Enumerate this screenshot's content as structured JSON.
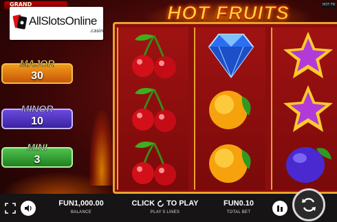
{
  "brand": {
    "grand_label": "GRAND",
    "site_name": "AllSlotsOnline",
    "site_sub": ".casino"
  },
  "game": {
    "title": "HOT FRUITS",
    "corner_tag": "HOT FR"
  },
  "jackpots": [
    {
      "label": "MAJOR",
      "value": "30"
    },
    {
      "label": "MINOR",
      "value": "10"
    },
    {
      "label": "MINI",
      "value": "3"
    }
  ],
  "reels": [
    [
      "cherry",
      "cherry",
      "cherry"
    ],
    [
      "diamond",
      "orange",
      "orange"
    ],
    [
      "star",
      "star",
      "plum"
    ]
  ],
  "controls": {
    "fullscreen_icon": "fullscreen-icon",
    "sound_icon": "speaker-icon",
    "balance_value": "FUN1,000.00",
    "balance_label": "BALANCE",
    "play_prefix": "CLICK",
    "play_suffix": "TO PLAY",
    "lines_label": "PLAY 5 LINES",
    "bet_value": "FUN0.10",
    "bet_label": "TOTAL BET",
    "coins_icon": "coin-stack-icon",
    "spin_icon": "spin-icon"
  },
  "colors": {
    "frame_gold": "#e9a42a",
    "reel_red": "#a01212",
    "major": "#f29a1a",
    "minor": "#6a4adf",
    "mini": "#4fc24f"
  }
}
